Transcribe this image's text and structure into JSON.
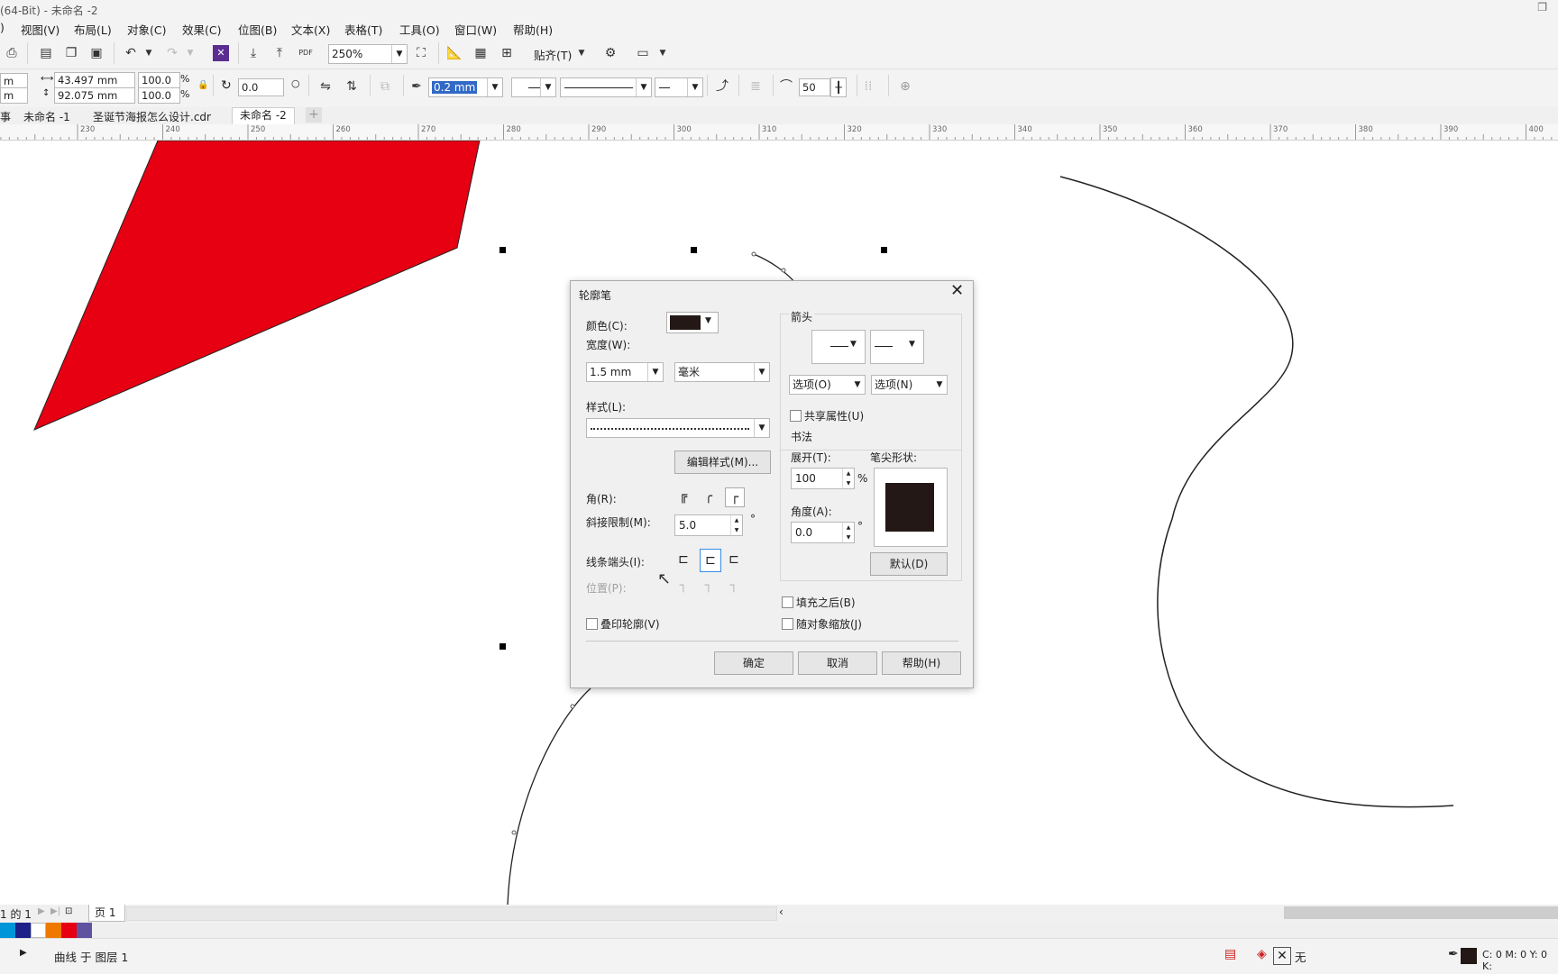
{
  "window": {
    "title": "(64-Bit) - 未命名 -2"
  },
  "menu": [
    "视图(V)",
    "布局(L)",
    "对象(C)",
    "效果(C)",
    "位图(B)",
    "文本(X)",
    "表格(T)",
    "工具(O)",
    "窗口(W)",
    "帮助(H)"
  ],
  "toolbar": {
    "zoom": "250%",
    "snap_label": "贴齐(T)"
  },
  "propbar": {
    "width_value": "43.497 mm",
    "height_value": "92.075 mm",
    "scale_x": "100.0",
    "scale_y": "100.0",
    "percent": "%",
    "rotation": "0.0",
    "outline_width": "0.2 mm",
    "smooth_value": "50",
    "left_unit": "m"
  },
  "doc_tabs": [
    "未命名 -1",
    "圣诞节海报怎么设计.cdr",
    "未命名 -2"
  ],
  "ruler_labels": [
    "230",
    "240",
    "250",
    "260",
    "270",
    "280",
    "290",
    "300",
    "310",
    "320",
    "330",
    "340",
    "350",
    "360",
    "370",
    "380",
    "390",
    "400"
  ],
  "dialog": {
    "title": "轮廓笔",
    "color_label": "颜色(C):",
    "width_label": "宽度(W):",
    "width_value": "1.5 mm",
    "unit_value": "毫米",
    "style_label": "样式(L):",
    "edit_style_button": "编辑样式(M)...",
    "corner_label": "角(R):",
    "miter_label": "斜接限制(M):",
    "miter_value": "5.0",
    "degree": "°",
    "linecap_label": "线条端头(I):",
    "position_label": "位置(P):",
    "overprint_label": "叠印轮廓(V)",
    "arrow_group": "箭头",
    "options_left": "选项(O)",
    "options_right": "选项(N)",
    "share_label": "共享属性(U)",
    "calligraphy_group": "书法",
    "stretch_label": "展开(T):",
    "stretch_value": "100",
    "percent": "%",
    "nib_label": "笔尖形状:",
    "angle_label": "角度(A):",
    "angle_value": "0.0",
    "default_button": "默认(D)",
    "behind_fill_label": "填充之后(B)",
    "scale_with_label": "随对象缩放(J)",
    "ok_button": "确定",
    "cancel_button": "取消",
    "help_button": "帮助(H)",
    "color_swatch": "#231815"
  },
  "pagebar": {
    "page_of": "1 的 1",
    "page_tab": "页 1"
  },
  "palette": [
    "#0095d9",
    "#1d2088",
    "#ffffff",
    "#ee7800",
    "#e60012",
    "#5f52a0"
  ],
  "status": {
    "object_info": "曲线 于 图层 1",
    "fill_none": "无",
    "cmyk": "C: 0 M: 0 Y: 0 K:"
  },
  "shape": {
    "fill": "#e60012"
  }
}
